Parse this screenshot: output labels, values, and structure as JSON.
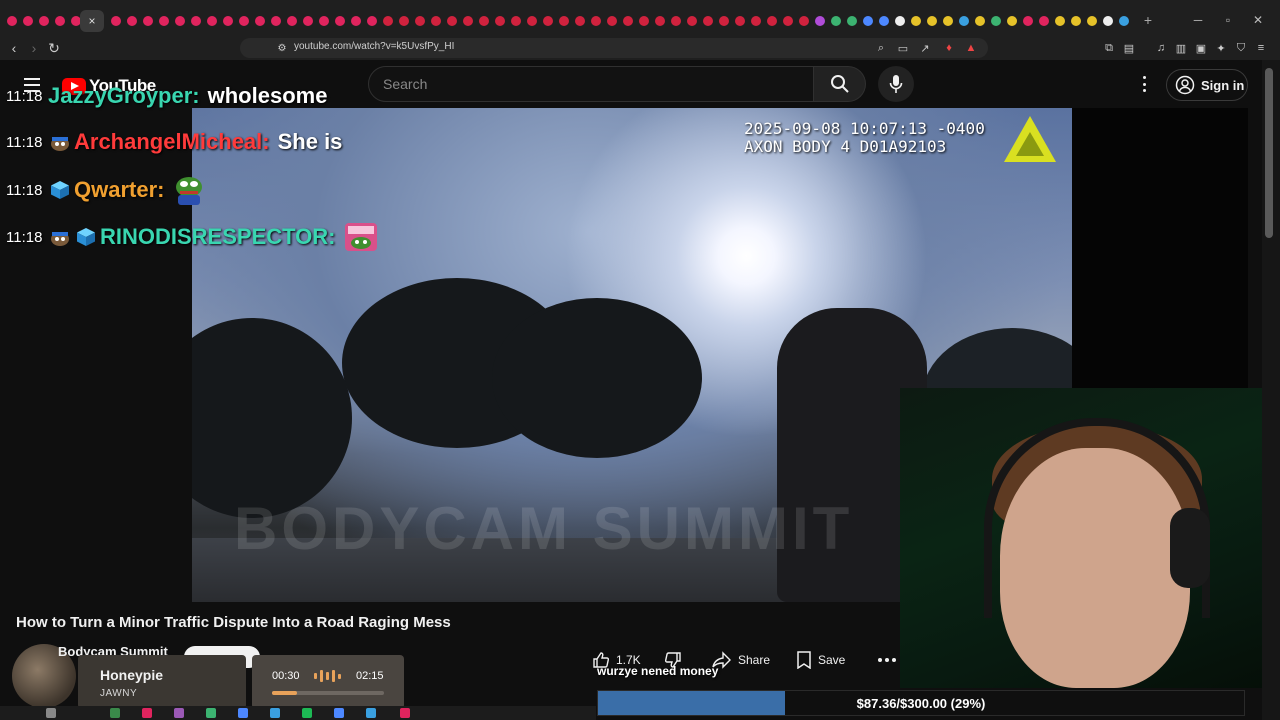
{
  "browser": {
    "tab_colors": [
      "#e0245e",
      "#e0245e",
      "#e0245e",
      "#e0245e",
      "#e0245e",
      "#e0245e",
      "#e0245e",
      "#e0245e",
      "#e0245e",
      "#e0245e",
      "#e0245e",
      "#e0245e",
      "#e0245e",
      "#e0245e",
      "#e0245e",
      "#e0245e",
      "#e0245e",
      "#e0245e",
      "#e0245e",
      "#e0245e",
      "#e0245e",
      "#e0245e",
      "#d0223e",
      "#d0223e",
      "#d0223e",
      "#d0223e",
      "#d0223e",
      "#d0223e",
      "#d0223e",
      "#d0223e",
      "#d0223e",
      "#d0223e",
      "#d0223e",
      "#d0223e",
      "#d0223e",
      "#d0223e",
      "#d0223e",
      "#d0223e",
      "#d0223e",
      "#d0223e",
      "#d0223e",
      "#d0223e",
      "#d0223e",
      "#d0223e",
      "#d0223e",
      "#d0223e",
      "#d0223e",
      "#d0223e",
      "#d0223e",
      "#b04cd8",
      "#3cb371",
      "#3cb371",
      "#4d88ff",
      "#4d88ff",
      "#eeeeee",
      "#e6c229",
      "#e6c229",
      "#e6c229",
      "#3aa0e0",
      "#e6c229",
      "#3cb371",
      "#e6c229",
      "#e0245e",
      "#e0245e",
      "#e6c229",
      "#e6c229",
      "#e6c229",
      "#eeeeee",
      "#3aa0e0"
    ],
    "active_tab_close": "×",
    "new_tab": "+",
    "url": "youtube.com/watch?v=k5UvsfPy_HI"
  },
  "youtube": {
    "logo_text": "YouTube",
    "search_placeholder": "Search",
    "sign_in": "Sign in"
  },
  "chat": [
    {
      "time": "11:18",
      "user": "JazzyGroyper:",
      "user_color": "#39d6b0",
      "message": "wholesome",
      "badges": []
    },
    {
      "time": "11:18",
      "user": "ArchangelMicheal:",
      "user_color": "#ff3b3b",
      "message": "She is",
      "badges": [
        "badge-emote"
      ]
    },
    {
      "time": "11:18",
      "user": "Qwarter:",
      "user_color": "#f0a030",
      "message": "",
      "badges": [
        "cube-badge"
      ],
      "emote": "pepe-emote"
    },
    {
      "time": "11:18",
      "user": "RINODISRESPECTOR:",
      "user_color": "#39d6b0",
      "message": "",
      "badges": [
        "badge-emote",
        "cube-badge"
      ],
      "emote": "mommy-emote"
    }
  ],
  "bodycam": {
    "timestamp_line1": "2025-09-08 10:07:13 -0400",
    "timestamp_line2": "AXON BODY 4 D01A92103",
    "watermark": "BODYCAM SUMMIT"
  },
  "video": {
    "title": "How to Turn a Minor Traffic Dispute Into a Road Raging Mess",
    "channel": "Bodycam Summit",
    "likes": "1.7K",
    "share_label": "Share",
    "save_label": "Save"
  },
  "music": {
    "title": "Honeypie",
    "artist": "JAWNY",
    "elapsed": "00:30",
    "duration": "02:15",
    "progress": 0.22
  },
  "donation": {
    "message": "wurzye nened money",
    "goal_text": "$87.36/$300.00 (29%)",
    "goal_fraction": 0.29
  }
}
